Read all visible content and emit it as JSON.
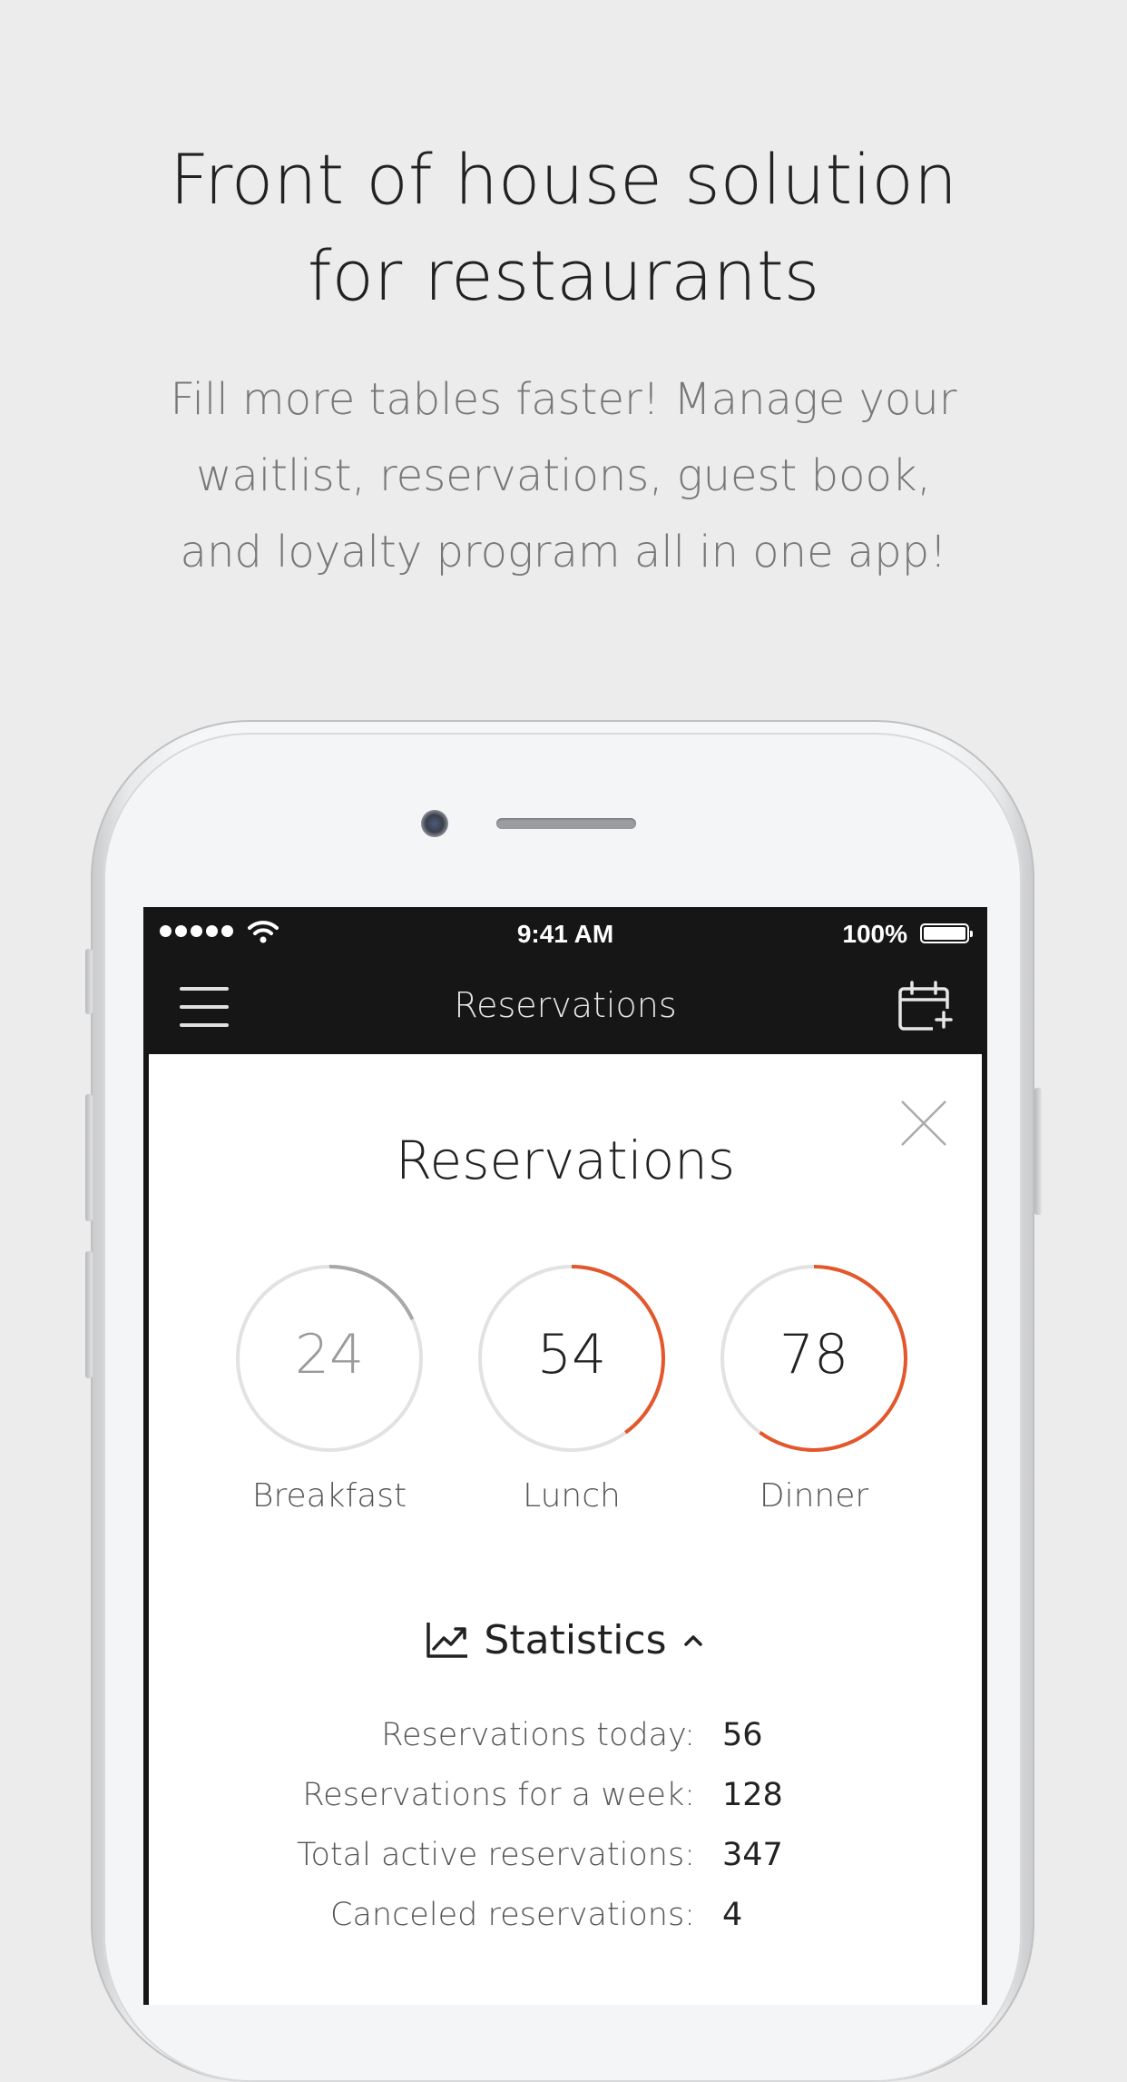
{
  "promo": {
    "headline_line1": "Front of house solution",
    "headline_line2": "for restaurants",
    "sub_line1": "Fill more tables faster! Manage your",
    "sub_line2": "waitlist, reservations, guest book,",
    "sub_line3": "and loyalty program all in one app!"
  },
  "status_bar": {
    "time": "9:41 AM",
    "battery": "100%"
  },
  "nav": {
    "title": "Reservations",
    "menu_icon": "hamburger-menu-icon",
    "calendar_icon": "calendar-add-icon"
  },
  "card": {
    "title": "Reservations",
    "close_icon": "close-icon",
    "meals": [
      {
        "label": "Breakfast",
        "count": "24",
        "fill": 0.18,
        "color": "#a8a8a8"
      },
      {
        "label": "Lunch",
        "count": "54",
        "fill": 0.4,
        "color": "#e3572b"
      },
      {
        "label": "Dinner",
        "count": "78",
        "fill": 0.6,
        "color": "#e3572b"
      }
    ]
  },
  "statistics": {
    "title": "Statistics",
    "icon": "chart-trend-icon",
    "toggle_icon": "chevron-up-icon",
    "rows": [
      {
        "label": "Reservations today:",
        "value": "56"
      },
      {
        "label": "Reservations for a week:",
        "value": "128"
      },
      {
        "label": "Total active reservations:",
        "value": "347"
      },
      {
        "label": "Canceled reservations:",
        "value": "4"
      }
    ]
  },
  "colors": {
    "accent": "#e3572b",
    "track": "#e2e2e2",
    "nav_bg": "#161616"
  }
}
